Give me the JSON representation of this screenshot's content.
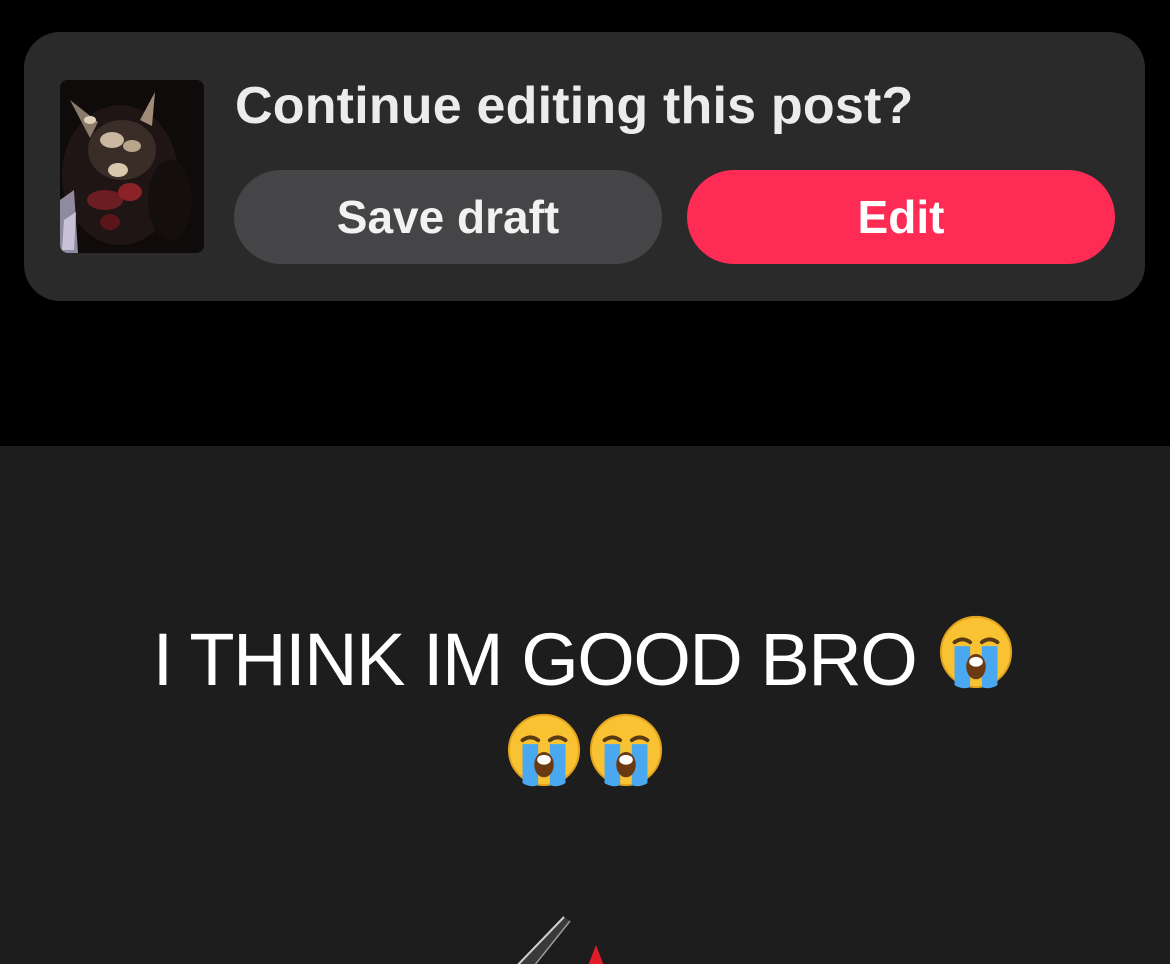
{
  "draft_prompt": {
    "title": "Continue editing this post?",
    "save_label": "Save draft",
    "edit_label": "Edit"
  },
  "post": {
    "caption_text": "I THINK IM GOOD BRO",
    "emoji": "loudly-crying-face"
  },
  "colors": {
    "background": "#000000",
    "card": "#2a2a2b",
    "save_button": "#454547",
    "edit_button": "#fe2c55",
    "post_background": "#1d1d1d"
  }
}
